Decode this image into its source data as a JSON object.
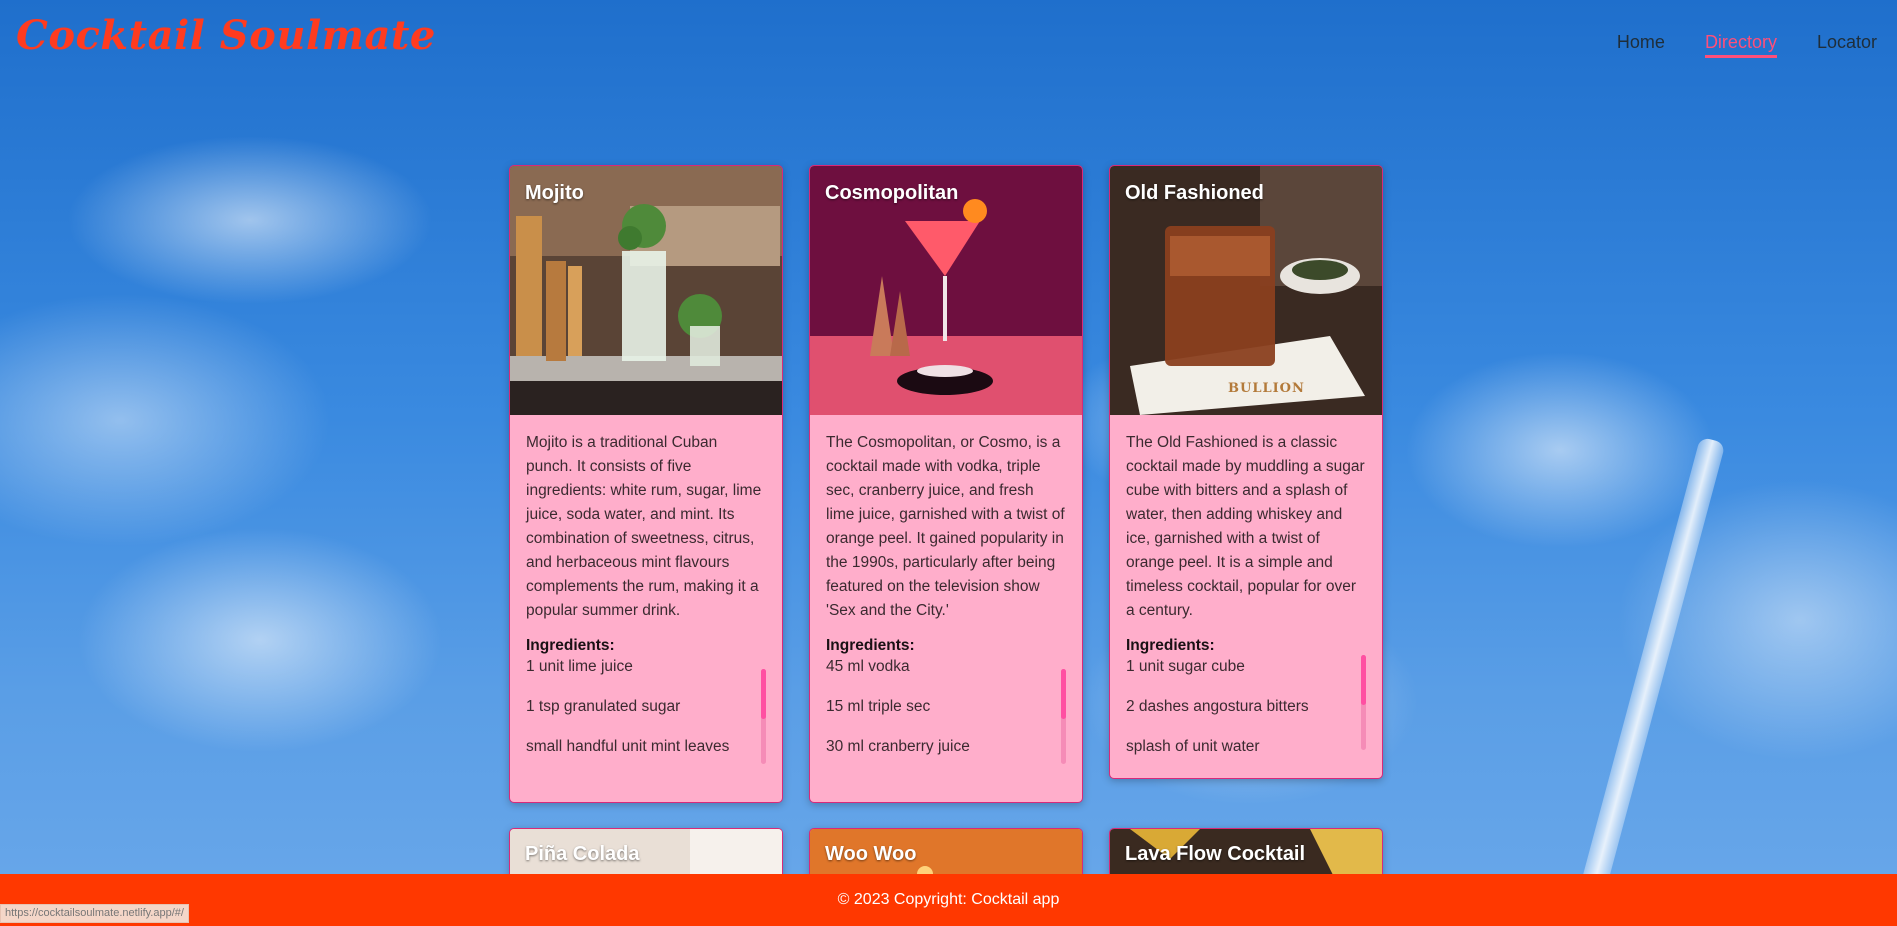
{
  "brand": "Cocktail Soulmate",
  "nav": {
    "home": "Home",
    "directory": "Directory",
    "locator": "Locator"
  },
  "cards": [
    {
      "title": "Mojito",
      "description": "Mojito is a traditional Cuban punch. It consists of five ingredients: white rum, sugar, lime juice, soda water, and mint. Its combination of sweetness, citrus, and herbaceous mint flavours complements the rum, making it a popular summer drink.",
      "ingredients_label": "Ingredients:",
      "ingredients": [
        "1 unit lime juice",
        "1 tsp granulated sugar",
        "small handful unit mint leaves"
      ]
    },
    {
      "title": "Cosmopolitan",
      "description": "The Cosmopolitan, or Cosmo, is a cocktail made with vodka, triple sec, cranberry juice, and fresh lime juice, garnished with a twist of orange peel. It gained popularity in the 1990s, particularly after being featured on the television show 'Sex and the City.'",
      "ingredients_label": "Ingredients:",
      "ingredients": [
        "45 ml vodka",
        "15 ml triple sec",
        "30 ml cranberry juice"
      ]
    },
    {
      "title": "Old Fashioned",
      "description": "The Old Fashioned is a classic cocktail made by muddling a sugar cube with bitters and a splash of water, then adding whiskey and ice, garnished with a twist of orange peel. It is a simple and timeless cocktail, popular for over a century.",
      "ingredients_label": "Ingredients:",
      "ingredients": [
        "1 unit sugar cube",
        "2 dashes angostura bitters",
        "splash of unit water"
      ],
      "image_text": "BULLION"
    },
    {
      "title": "Piña Colada"
    },
    {
      "title": "Woo Woo"
    },
    {
      "title": "Lava Flow Cocktail"
    }
  ],
  "footer": "© 2023 Copyright: Cocktail app",
  "status_url": "https://cocktailsoulmate.netlify.app/#/"
}
